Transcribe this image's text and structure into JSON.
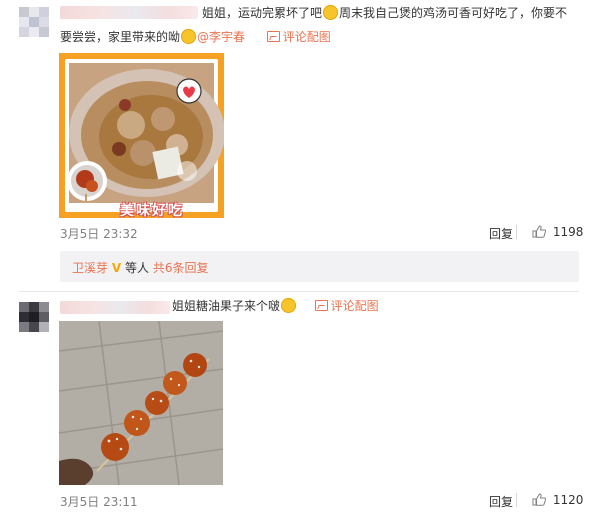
{
  "comments": [
    {
      "text_a": "姐姐，运动完累坏了吧",
      "text_b": "周末我自己煲的鸡汤可香可好吃了，你要不",
      "text_c": "要尝尝，家里带来的呦",
      "mention": "@李宇春",
      "pic_link": "评论配图",
      "image_caption": "美味好吃",
      "time": "3月5日 23:32",
      "reply_label": "回复",
      "likes": "1198",
      "sub_replies": {
        "user": "卫溪芽",
        "badge": "V",
        "text_mid": "等人",
        "count_link": "共6条回复"
      }
    },
    {
      "text_a": "姐姐糖油果子来个啵",
      "pic_link": "评论配图",
      "time": "3月5日 23:11",
      "reply_label": "回复",
      "likes": "1120"
    }
  ],
  "colors": {
    "link": "#eb7350",
    "badge": "#f6a800",
    "card_bg": "#f2f2f5"
  }
}
